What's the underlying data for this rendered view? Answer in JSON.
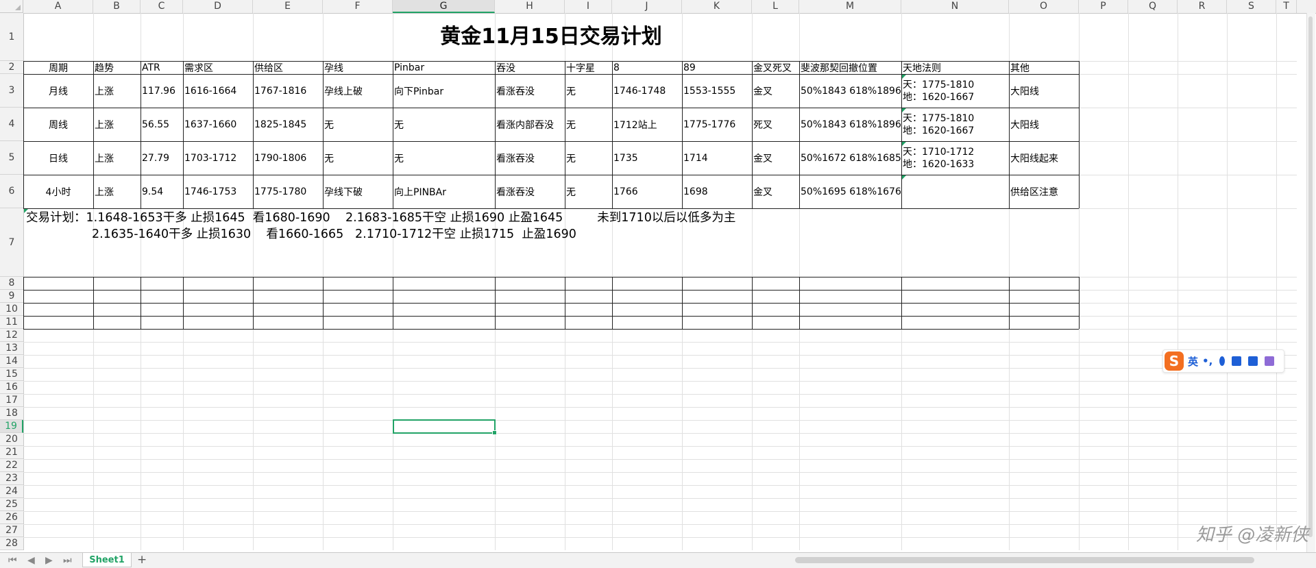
{
  "columns": [
    "A",
    "B",
    "C",
    "D",
    "E",
    "F",
    "G",
    "H",
    "I",
    "J",
    "K",
    "L",
    "M",
    "N",
    "O",
    "P",
    "Q",
    "R",
    "S",
    "T"
  ],
  "selected_column": "G",
  "rows": [
    "1",
    "2",
    "3",
    "4",
    "5",
    "6",
    "7",
    "8",
    "9",
    "10",
    "11",
    "12",
    "13",
    "14",
    "15",
    "16",
    "17",
    "18",
    "19",
    "20",
    "21",
    "22",
    "23",
    "24",
    "25",
    "26",
    "27",
    "28"
  ],
  "selected_row": "19",
  "title": "黄金11月15日交易计划",
  "table": {
    "headers": [
      "周期",
      "趋势",
      "ATR",
      "需求区",
      "供给区",
      "孕线",
      "Pinbar",
      "吞没",
      "十字星",
      "8",
      "89",
      "金叉死叉",
      "斐波那契回撤位置",
      "天地法则",
      "其他"
    ],
    "rows": [
      {
        "period": "月线",
        "trend": "上涨",
        "atr": "117.96",
        "demand": "1616-1664",
        "supply": "1767-1816",
        "inside": "孕线上破",
        "pinbar": "向下Pinbar",
        "engulf": "看涨吞没",
        "doji": "无",
        "ma8": "1746-1748",
        "ma89": "1553-1555",
        "cross": "金叉",
        "fib": "50%1843 618%1896",
        "sky": "天：1775-1810",
        "earth": "地：1620-1667",
        "other": "大阳线"
      },
      {
        "period": "周线",
        "trend": "上涨",
        "atr": "56.55",
        "demand": "1637-1660",
        "supply": "1825-1845",
        "inside": "无",
        "pinbar": "无",
        "engulf": "看涨内部吞没",
        "doji": "无",
        "ma8": "1712站上",
        "ma89": "1775-1776",
        "cross": "死叉",
        "fib": "50%1843 618%1896",
        "sky": "天：1775-1810",
        "earth": "地：1620-1667",
        "other": "大阳线"
      },
      {
        "period": "日线",
        "trend": "上涨",
        "atr": "27.79",
        "demand": "1703-1712",
        "supply": "1790-1806",
        "inside": "无",
        "pinbar": "无",
        "engulf": "看涨吞没",
        "doji": "无",
        "ma8": "1735",
        "ma89": "1714",
        "cross": "金叉",
        "fib": "50%1672 618%1685",
        "sky": "天：1710-1712",
        "earth": "地：1620-1633",
        "other": "大阳线起来"
      },
      {
        "period": "4小时",
        "trend": "上涨",
        "atr": "9.54",
        "demand": "1746-1753",
        "supply": "1775-1780",
        "inside": "孕线下破",
        "pinbar": "向上PINBAr",
        "engulf": "看涨吞没",
        "doji": "无",
        "ma8": "1766",
        "ma89": "1698",
        "cross": "金叉",
        "fib": "50%1695 618%1676",
        "sky": "",
        "earth": "",
        "other": "供给区注意"
      }
    ]
  },
  "plan": {
    "line1": "交易计划：1.1648-1653干多 止损1645  看1680-1690    2.1683-1685干空 止损1690 止盈1645         未到1710以后以低多为主",
    "line2": "2.1635-1640干多 止损1630    看1660-1665   2.1710-1712干空 止损1715  止盈1690"
  },
  "sheet_tab": "Sheet1",
  "add_sheet": "+",
  "nav": [
    "⏮",
    "◀",
    "▶",
    "⏭"
  ],
  "ime": {
    "lang": "英",
    "logo": "S",
    "punct": "•,"
  },
  "watermark": "知乎 @凌新侠",
  "colors": {
    "accent": "#21a366",
    "ime_brand": "#f36f21"
  }
}
